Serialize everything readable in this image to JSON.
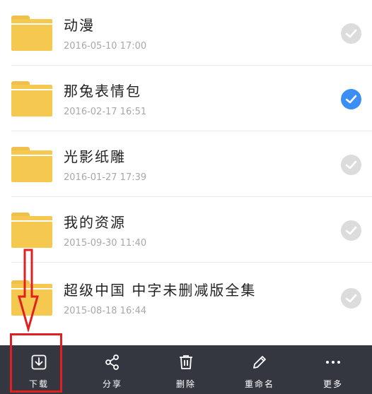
{
  "files": [
    {
      "name": "动漫",
      "date": "2016-05-10 17:00",
      "selected": false
    },
    {
      "name": "那兔表情包",
      "date": "2016-02-17 16:51",
      "selected": true
    },
    {
      "name": "光影纸雕",
      "date": "2016-01-27 17:39",
      "selected": false
    },
    {
      "name": "我的资源",
      "date": "2015-09-30 11:40",
      "selected": false
    },
    {
      "name": "超级中国 中字未删减版全集",
      "date": "2015-08-18 16:44",
      "selected": false
    }
  ],
  "toolbar": {
    "download": "下载",
    "share": "分享",
    "delete": "删除",
    "rename": "重命名",
    "more": "更多"
  },
  "colors": {
    "folder": "#f5c84f",
    "selected_check": "#3a8ef6",
    "toolbar_bg": "#343640",
    "annotation": "#e02020"
  }
}
